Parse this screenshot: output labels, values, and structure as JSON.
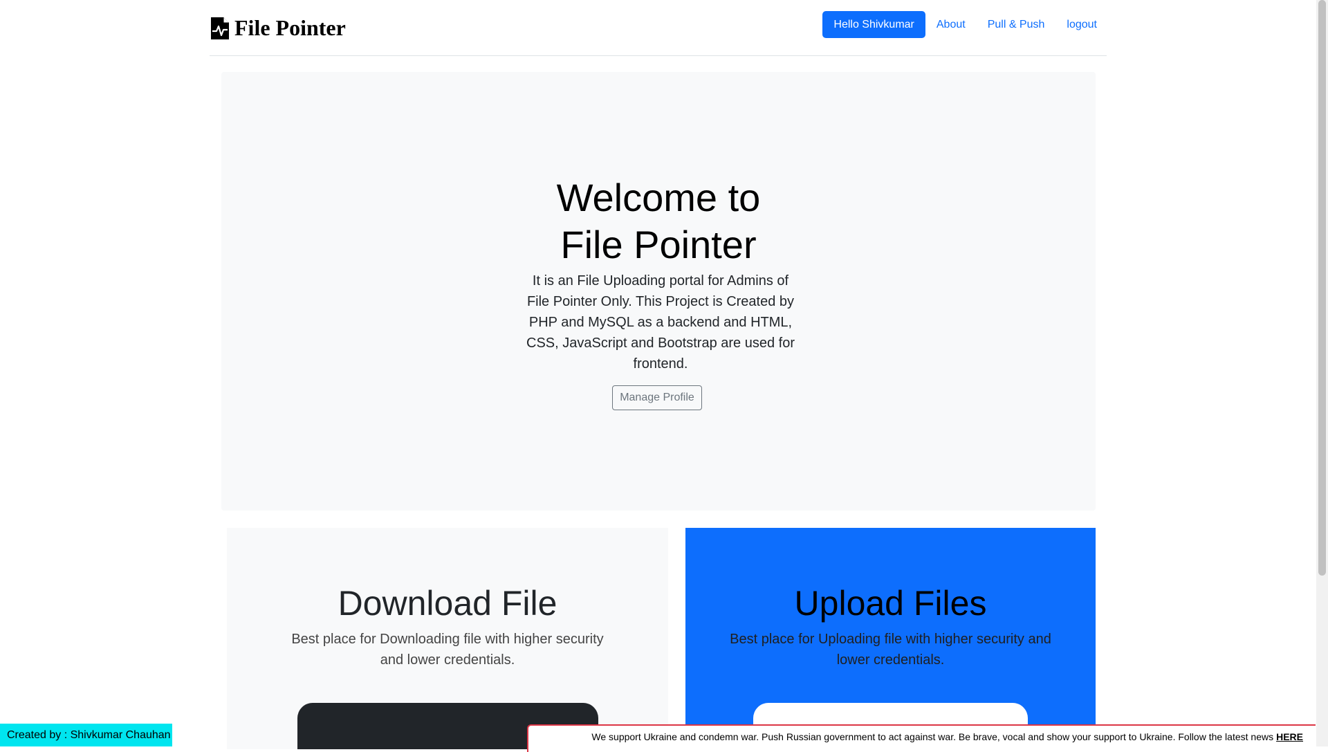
{
  "header": {
    "brand": "File Pointer",
    "nav": {
      "user_pill": "Hello Shivkumar",
      "about": "About",
      "pull_push": "Pull & Push",
      "logout": "logout"
    }
  },
  "hero": {
    "title_line1": "Welcome to",
    "title_line2": "File Pointer",
    "description": "It is an File Uploading portal for Admins of File Pointer Only. This Project is Created by PHP and MySQL as a backend and HTML, CSS, JavaScript and Bootstrap are used for frontend.",
    "manage_button": "Manage Profile"
  },
  "panels": {
    "download": {
      "title": "Download File",
      "description": "Best place for Downloading file with higher security and lower credentials."
    },
    "upload": {
      "title": "Upload Files",
      "description": "Best place for Uploading file with higher security and lower credentials."
    }
  },
  "footer": {
    "creator": "Created by : Shivkumar Chauhan"
  },
  "ukraine_banner": {
    "text": "We support Ukraine and condemn war. Push Russian government to act against war. Be brave, vocal and show your support to Ukraine. Follow the latest news",
    "link": "HERE"
  },
  "colors": {
    "primary": "#0d6efd",
    "light_bg": "#f8f9fa",
    "dark_card": "#212529",
    "creator_bg": "#00e5ef",
    "banner_border": "#dc3545"
  },
  "icons": {
    "brand": "file-pulse-icon"
  }
}
